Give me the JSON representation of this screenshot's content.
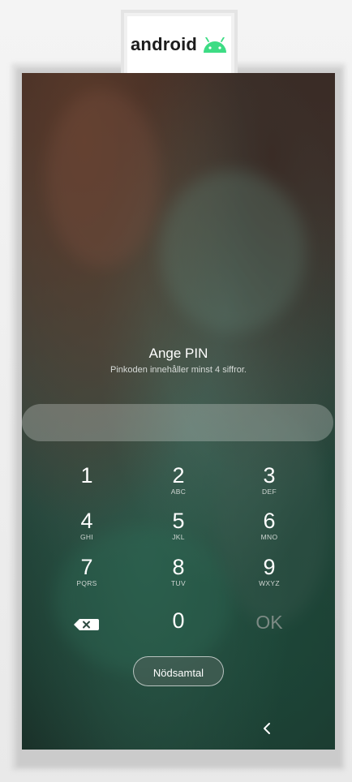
{
  "logo": {
    "text": "android",
    "icon": "android-robot-head-icon",
    "icon_color": "#3ddc84"
  },
  "lock_screen": {
    "title": "Ange PIN",
    "subtitle": "Pinkoden innehåller minst 4 siffror.",
    "pin_value": "",
    "keypad": [
      {
        "digit": "1",
        "letters": ""
      },
      {
        "digit": "2",
        "letters": "ABC"
      },
      {
        "digit": "3",
        "letters": "DEF"
      },
      {
        "digit": "4",
        "letters": "GHI"
      },
      {
        "digit": "5",
        "letters": "JKL"
      },
      {
        "digit": "6",
        "letters": "MNO"
      },
      {
        "digit": "7",
        "letters": "PQRS"
      },
      {
        "digit": "8",
        "letters": "TUV"
      },
      {
        "digit": "9",
        "letters": "WXYZ"
      },
      {
        "digit": "0",
        "letters": ""
      }
    ],
    "backspace_icon": "backspace-icon",
    "ok_label": "OK",
    "emergency_label": "Nödsamtal",
    "back_icon": "chevron-left-icon"
  }
}
